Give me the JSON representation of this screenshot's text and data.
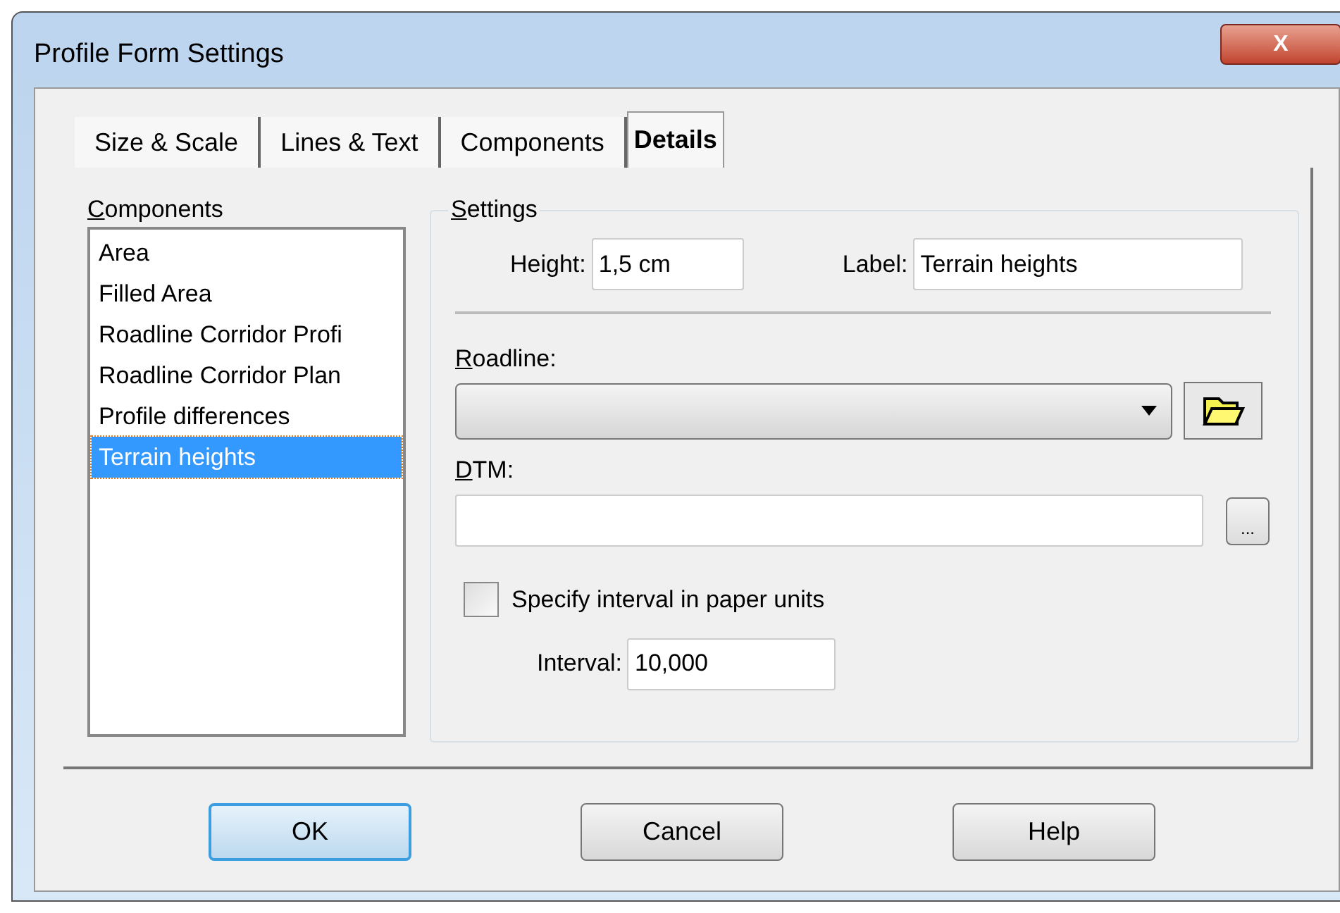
{
  "window": {
    "title": "Profile Form Settings",
    "close_label": "X"
  },
  "tabs": [
    {
      "label": "Size & Scale",
      "selected": false
    },
    {
      "label": "Lines & Text",
      "selected": false
    },
    {
      "label": "Components",
      "selected": false
    },
    {
      "label": "Details",
      "selected": true
    }
  ],
  "components": {
    "label": "Components",
    "items": [
      {
        "label": "Area",
        "selected": false
      },
      {
        "label": "Filled Area",
        "selected": false
      },
      {
        "label": "Roadline Corridor Profi",
        "selected": false
      },
      {
        "label": "Roadline Corridor Plan",
        "selected": false
      },
      {
        "label": "Profile differences",
        "selected": false
      },
      {
        "label": "Terrain heights",
        "selected": true
      }
    ]
  },
  "settings": {
    "title": "Settings",
    "height": {
      "label": "Height:",
      "value": "1,5 cm"
    },
    "label_field": {
      "label": "Label:",
      "value": "Terrain heights"
    },
    "roadline": {
      "label": "Roadline:"
    },
    "dtm": {
      "label": "DTM:",
      "browse_label": "..."
    },
    "paper_units": {
      "label": "Specify interval in paper units",
      "checked": false
    },
    "interval": {
      "label": "Interval:",
      "value": "10,000"
    }
  },
  "buttons": [
    {
      "label": "OK",
      "default": true
    },
    {
      "label": "Cancel",
      "default": false
    },
    {
      "label": "Help",
      "default": false
    }
  ]
}
